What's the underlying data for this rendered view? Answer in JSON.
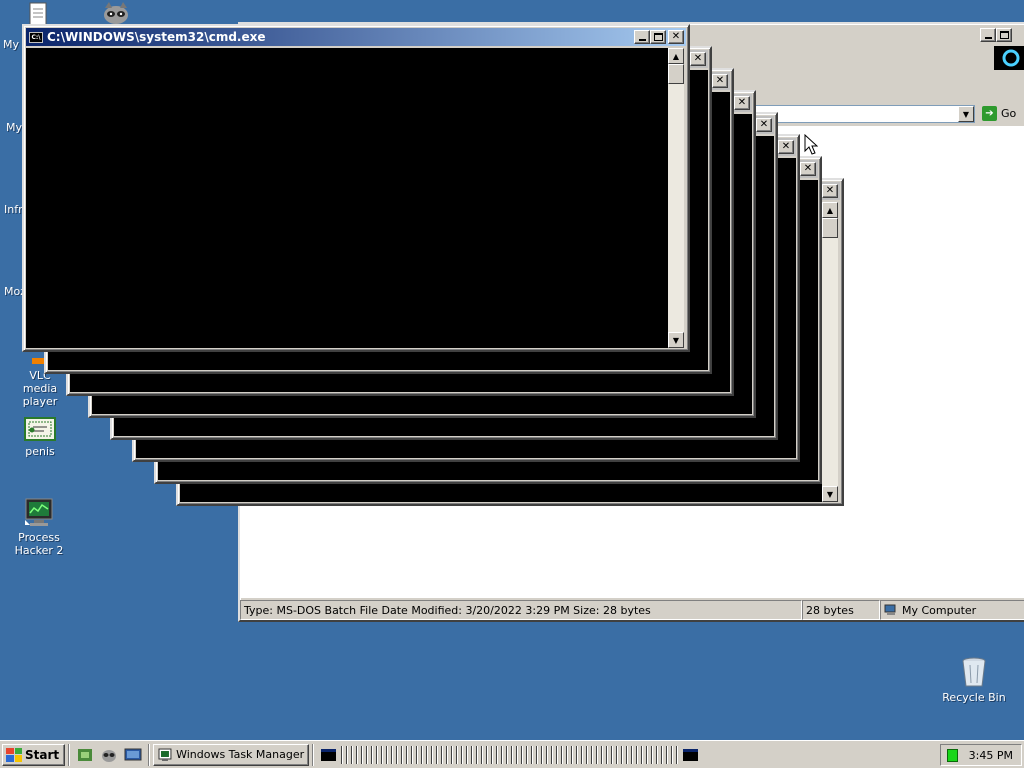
{
  "desktop": {
    "icons": [
      {
        "label": "VLC media player"
      },
      {
        "label": "penis"
      },
      {
        "label": "Process Hacker 2"
      },
      {
        "label": "Recycle Bin"
      }
    ],
    "partial_icons": [
      {
        "label": "My I"
      },
      {
        "label": "My"
      },
      {
        "label": "Infr"
      },
      {
        "label": "Moz"
      }
    ]
  },
  "cmd_window": {
    "title": "C:\\WINDOWS\\system32\\cmd.exe",
    "console_bg": "#000000"
  },
  "explorer": {
    "go_label": "Go",
    "status": {
      "info": "Type: MS-DOS Batch File Date Modified: 3/20/2022 3:29 PM Size: 28 bytes",
      "size": "28 bytes",
      "zone": "My Computer"
    }
  },
  "taskbar": {
    "start_label": "Start",
    "task_manager_label": "Windows Task Manager",
    "clock": "3:45 PM"
  },
  "colors": {
    "desktop": "#3a6ea5",
    "title_active": "#0a246a",
    "face": "#d4d0c8"
  }
}
